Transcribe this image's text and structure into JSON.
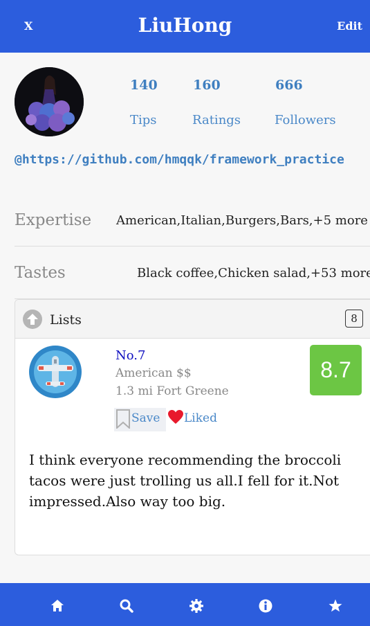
{
  "header": {
    "close_label": "X",
    "title": "LiuHong",
    "edit_label": "Edit"
  },
  "profile": {
    "stats": [
      {
        "count": "140",
        "label": "Tips"
      },
      {
        "count": "160",
        "label": "Ratings"
      },
      {
        "count": "666",
        "label": "Followers"
      }
    ],
    "link": "@https://github.com/hmqqk/framework_practice",
    "expertise_label": "Expertise",
    "expertise_value": "American,Italian,Burgers,Bars,+5 more",
    "tastes_label": "Tastes",
    "tastes_value": "Black coffee,Chicken salad,+53 more"
  },
  "lists": {
    "title": "Lists",
    "count": "8",
    "item": {
      "name": "No.7",
      "category": "American $$",
      "location": "1.3 mi Fort Greene",
      "score": "8.7",
      "save_label": "Save",
      "liked_label": "Liked",
      "review": "I think everyone recommending the broccoli tacos were just trolling us all.I fell for it.Not impressed.Also way too big."
    }
  },
  "colors": {
    "accent": "#2c5ddd",
    "score_bg": "#6cc644",
    "link": "#3f7fc0",
    "heart": "#e8192c"
  },
  "tabbar": {
    "icons": [
      "home-icon",
      "search-icon",
      "gear-icon",
      "info-icon",
      "star-icon"
    ]
  }
}
